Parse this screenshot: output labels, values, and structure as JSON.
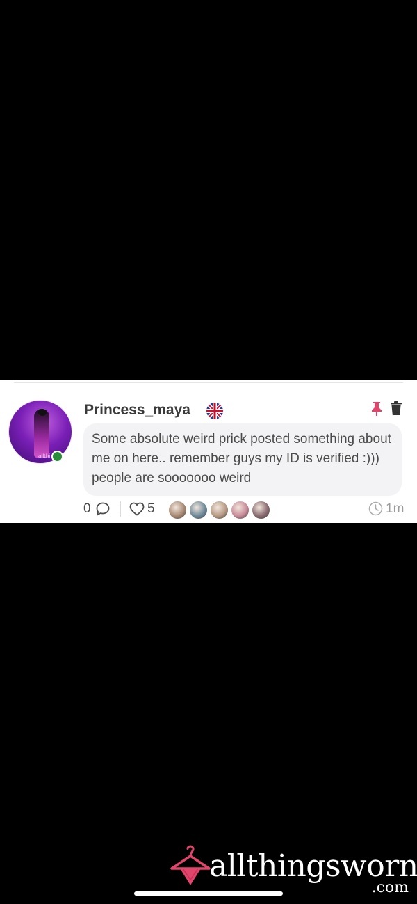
{
  "post": {
    "username": "Princess_maya",
    "country_flag": "uk-flag",
    "avatar_watermark": "allthi",
    "text": "Some absolute weird prick posted something about me on here.. remember guys my ID is verified :))) people are sooooooo weird",
    "comments_count": "0",
    "likes_count": "5",
    "time_ago": "1m",
    "liker_avatar_colors": [
      "#a88a74",
      "#6f8a9a",
      "#b69a84",
      "#c98b9a",
      "#8a6c72"
    ]
  },
  "icons": {
    "pin": "pin-icon",
    "trash": "trash-icon",
    "comment": "comment-icon",
    "heart": "heart-icon",
    "clock": "clock-icon",
    "online": "online-status-dot"
  },
  "colors": {
    "accent": "#e0456b",
    "text": "#4a4a4a",
    "username": "#3b3b3b",
    "bubble": "#f3f3f5",
    "online": "#2a8d3a"
  },
  "brand": {
    "logo_text": "allthingsworn",
    "logo_domain": ".com"
  }
}
